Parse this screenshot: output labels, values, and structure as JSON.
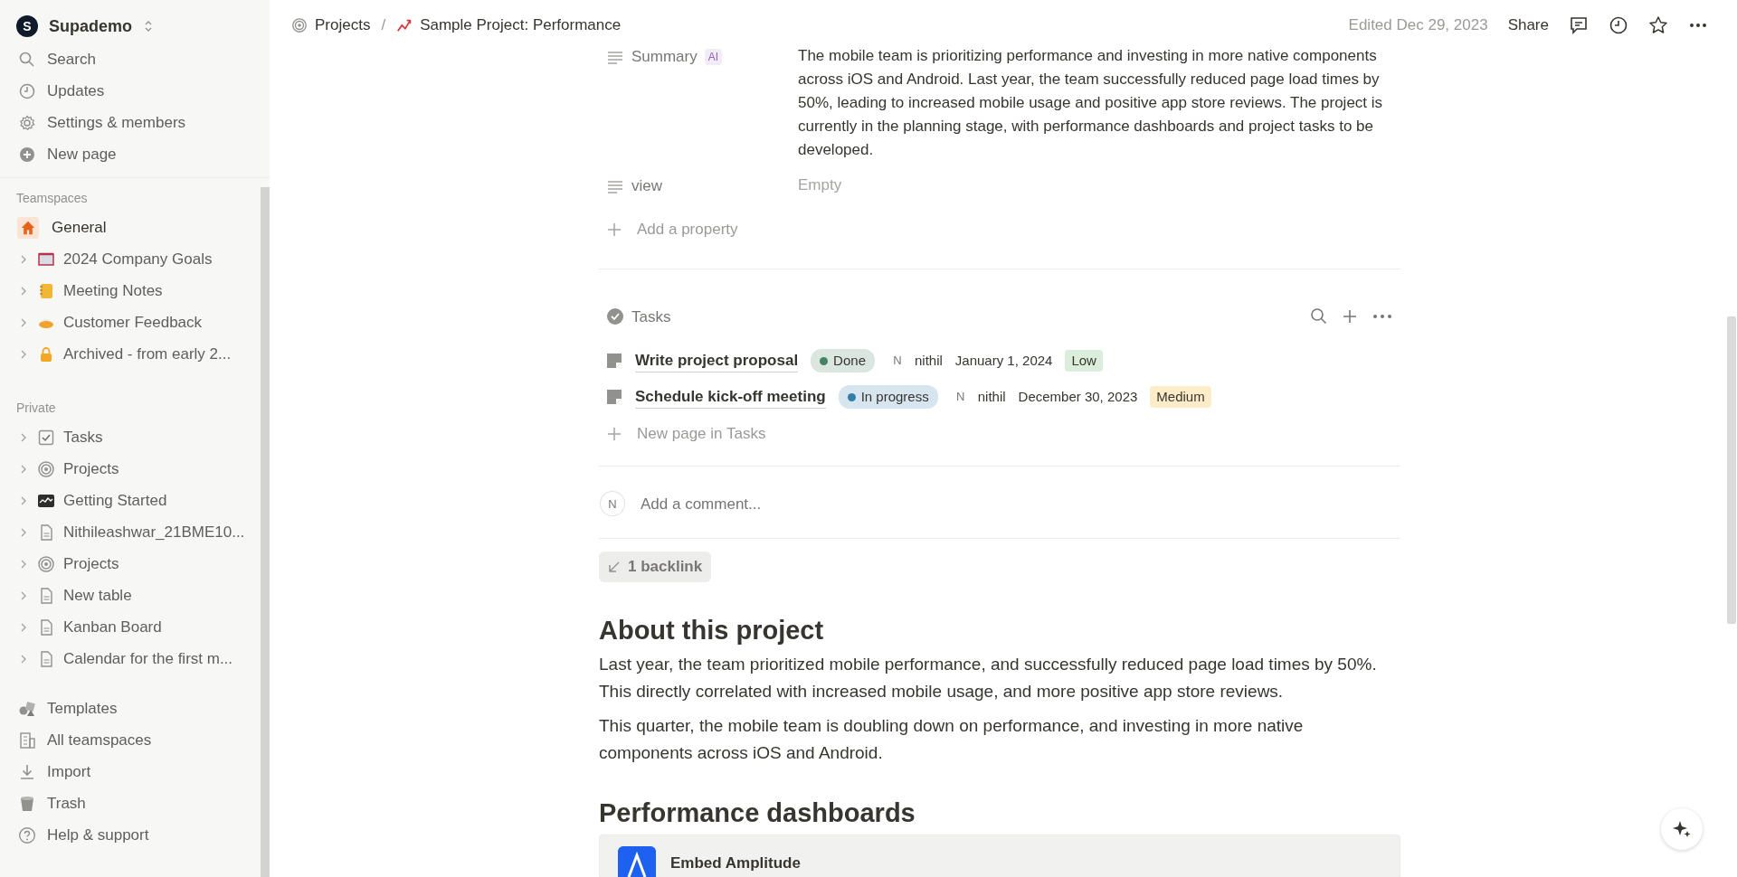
{
  "workspace": {
    "name": "Supademo",
    "initial": "S"
  },
  "sidebar": {
    "top_items": [
      {
        "label": "Search",
        "kind": "search"
      },
      {
        "label": "Updates",
        "kind": "clock"
      },
      {
        "label": "Settings & members",
        "kind": "gear"
      },
      {
        "label": "New page",
        "kind": "plus-circle"
      }
    ],
    "sections": [
      {
        "heading": "Teamspaces",
        "items": [
          {
            "label": "General",
            "kind": "home",
            "expandable": false
          },
          {
            "label": "2024 Company Goals",
            "kind": "board",
            "expandable": true
          },
          {
            "label": "Meeting Notes",
            "kind": "notebook",
            "expandable": true
          },
          {
            "label": "Customer Feedback",
            "kind": "dish",
            "expandable": true
          },
          {
            "label": "Archived - from early 2...",
            "kind": "lock",
            "expandable": true
          }
        ]
      },
      {
        "heading": "Private",
        "items": [
          {
            "label": "Tasks",
            "kind": "checkbox",
            "expandable": true
          },
          {
            "label": "Projects",
            "kind": "target",
            "expandable": true
          },
          {
            "label": "Getting Started",
            "kind": "chart-tile",
            "expandable": true
          },
          {
            "label": "Nithileashwar_21BME10...",
            "kind": "doc",
            "expandable": true
          },
          {
            "label": "Projects",
            "kind": "target",
            "expandable": true
          },
          {
            "label": "New table",
            "kind": "doc",
            "expandable": true
          },
          {
            "label": "Kanban Board",
            "kind": "doc",
            "expandable": true
          },
          {
            "label": "Calendar for the first m...",
            "kind": "doc",
            "expandable": true
          }
        ]
      }
    ],
    "bottom_items": [
      {
        "label": "Templates",
        "kind": "shapes"
      },
      {
        "label": "All teamspaces",
        "kind": "building"
      },
      {
        "label": "Import",
        "kind": "download"
      },
      {
        "label": "Trash",
        "kind": "trash"
      },
      {
        "label": "Help & support",
        "kind": "help"
      }
    ]
  },
  "breadcrumb": [
    {
      "label": "Projects",
      "kind": "target"
    },
    {
      "label": "Sample Project: Performance",
      "kind": "trend"
    }
  ],
  "breadcrumb_separator": "/",
  "header": {
    "edited": "Edited Dec 29, 2023",
    "share": "Share"
  },
  "properties": [
    {
      "name": "Summary",
      "badge": "AI",
      "value": "The mobile team is prioritizing performance and investing in more native components across iOS and Android. Last year, the team successfully reduced page load times by 50%, leading to increased mobile usage and positive app store reviews. The project is currently in the planning stage, with performance dashboards and project tasks to be developed.",
      "empty": false
    },
    {
      "name": "view",
      "value": "Empty",
      "empty": true
    }
  ],
  "add_property": "Add a property",
  "tasks": {
    "title": "Tasks",
    "rows": [
      {
        "title": "Write project proposal",
        "status": {
          "label": "Done",
          "color": "#448361"
        },
        "assignee_initial": "N",
        "assignee": "nithil",
        "date": "January 1, 2024",
        "priority": {
          "label": "Low",
          "color": "#dbeddb"
        }
      },
      {
        "title": "Schedule kick-off meeting",
        "status": {
          "label": "In progress",
          "color": "#337ea9"
        },
        "assignee_initial": "N",
        "assignee": "nithil",
        "date": "December 30, 2023",
        "priority": {
          "label": "Medium",
          "color": "#fdecc8"
        }
      }
    ],
    "new_page": "New page in Tasks"
  },
  "comment": {
    "avatar": "N",
    "placeholder": "Add a comment..."
  },
  "backlink": "1 backlink",
  "blocks": [
    {
      "kind": "heading",
      "text": "About this project"
    },
    {
      "kind": "paragraph",
      "text": "Last year, the team prioritized mobile performance, and successfully reduced page load times by 50%. This directly correlated with increased mobile usage, and more positive app store reviews."
    },
    {
      "kind": "paragraph",
      "text": "This quarter, the mobile team is doubling down on performance, and investing in more native components across iOS and Android."
    },
    {
      "kind": "heading",
      "text": "Performance dashboards"
    },
    {
      "kind": "embed",
      "text": "Embed Amplitude"
    }
  ]
}
